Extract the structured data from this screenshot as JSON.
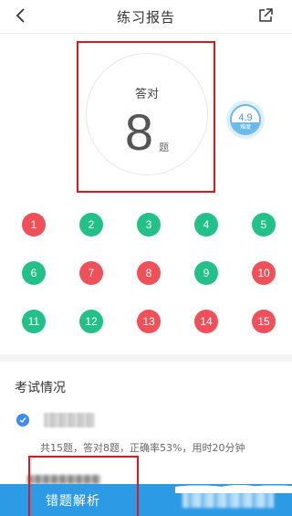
{
  "header": {
    "title": "练习报告",
    "back_icon": "chevron-left-icon",
    "share_icon": "share-external-icon"
  },
  "score": {
    "label": "答对",
    "value": "8",
    "unit": "题"
  },
  "difficulty": {
    "value": "4.9",
    "label": "难度"
  },
  "questions": [
    {
      "num": "1",
      "status": "wrong"
    },
    {
      "num": "2",
      "status": "correct"
    },
    {
      "num": "3",
      "status": "correct"
    },
    {
      "num": "4",
      "status": "correct"
    },
    {
      "num": "5",
      "status": "correct"
    },
    {
      "num": "6",
      "status": "correct"
    },
    {
      "num": "7",
      "status": "wrong"
    },
    {
      "num": "8",
      "status": "wrong"
    },
    {
      "num": "9",
      "status": "correct"
    },
    {
      "num": "10",
      "status": "wrong"
    },
    {
      "num": "11",
      "status": "correct"
    },
    {
      "num": "12",
      "status": "correct"
    },
    {
      "num": "13",
      "status": "wrong"
    },
    {
      "num": "14",
      "status": "wrong"
    },
    {
      "num": "15",
      "status": "wrong"
    }
  ],
  "exam": {
    "section_title": "考试情况",
    "summary": "共15题，答对8题，正确率53%，用时20分钟"
  },
  "bottom": {
    "review_button": "错题解析"
  },
  "colors": {
    "correct": "#24c08a",
    "wrong": "#f0505a",
    "accent": "#2d9ae6",
    "highlight_box": "#e0171e"
  }
}
